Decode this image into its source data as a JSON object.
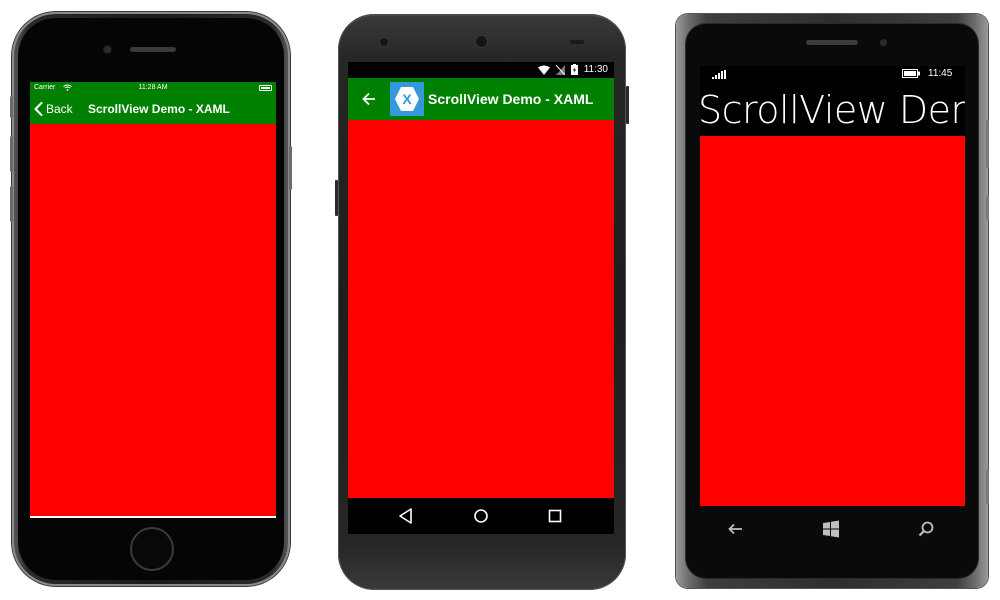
{
  "ios": {
    "carrier": "Carrier",
    "time": "11:28 AM",
    "back_label": "Back",
    "title": "ScrollView Demo - XAML",
    "nav_color": "#008000",
    "content_color": "#ff0000"
  },
  "android": {
    "time": "11:30",
    "title": "ScrollView Demo - XAML",
    "logo_letter": "X",
    "bar_color": "#008000",
    "content_color": "#ff0000"
  },
  "windows_phone": {
    "time": "11:45",
    "title": "ScrollView Demo",
    "content_color": "#ff0000"
  }
}
